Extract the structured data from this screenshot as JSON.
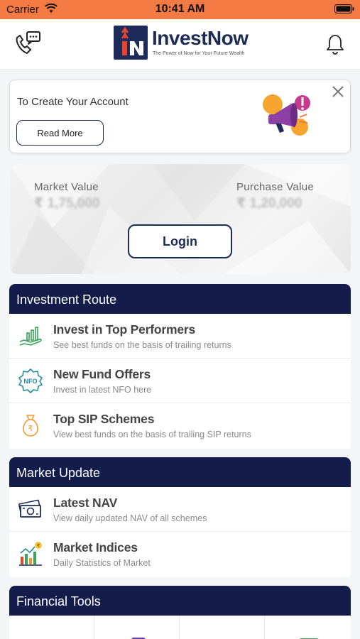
{
  "status_bar": {
    "carrier": "Carrier",
    "time": "10:41 AM"
  },
  "header": {
    "brand": "InvestNow",
    "tagline": "The Power of Now for Your Future Wealth",
    "logo_mark_text": "iN"
  },
  "promo": {
    "title": "To Create Your Account",
    "read_more_label": "Read More"
  },
  "portfolio": {
    "market_value_label": "Market Value",
    "market_value": "₹ 1,75,000",
    "purchase_value_label": "Purchase Value",
    "purchase_value": "₹ 1,20,000",
    "login_label": "Login"
  },
  "investment_route": {
    "title": "Investment Route",
    "items": [
      {
        "title": "Invest in Top Performers",
        "subtitle": "See best funds on the basis of trailing returns",
        "icon": "growth-hand-icon"
      },
      {
        "title": "New Fund Offers",
        "subtitle": "Invest in latest NFO here",
        "icon": "nfo-badge-icon"
      },
      {
        "title": "Top SIP Schemes",
        "subtitle": "View best funds on the basis of trailing SIP returns",
        "icon": "money-bag-icon"
      }
    ]
  },
  "market_update": {
    "title": "Market Update",
    "items": [
      {
        "title": "Latest NAV",
        "subtitle": "View daily updated NAV of all schemes",
        "icon": "banknote-icon"
      },
      {
        "title": "Market Indices",
        "subtitle": "Daily Statistics of Market",
        "icon": "bar-chart-icon"
      }
    ]
  },
  "financial_tools": {
    "title": "Financial Tools"
  },
  "colors": {
    "status_bar": "#f47a44",
    "navy": "#141c4b",
    "brand_red": "#e8452c",
    "green": "#3aa35b",
    "orange": "#f29a2e"
  }
}
